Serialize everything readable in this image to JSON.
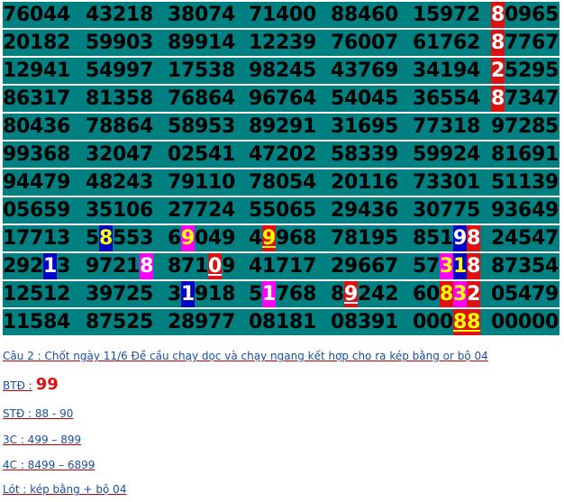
{
  "grid": {
    "rows": [
      [
        "76044",
        "43218",
        "38074",
        "71400",
        "88460",
        "15972",
        "80965"
      ],
      [
        "20182",
        "59903",
        "89914",
        "12239",
        "76007",
        "61762",
        "87767"
      ],
      [
        "12941",
        "54997",
        "17538",
        "98245",
        "43769",
        "34194",
        "25295"
      ],
      [
        "86317",
        "81358",
        "76864",
        "96764",
        "54045",
        "36554",
        "87347"
      ],
      [
        "80436",
        "78864",
        "58953",
        "89291",
        "31695",
        "77318",
        "97285"
      ],
      [
        "99368",
        "32047",
        "02541",
        "47202",
        "58339",
        "59924",
        "81691"
      ],
      [
        "94479",
        "48243",
        "79110",
        "78054",
        "20116",
        "73301",
        "51139"
      ],
      [
        "05659",
        "35106",
        "27724",
        "55065",
        "29436",
        "30775",
        "93649"
      ],
      [
        "17713",
        "58553",
        "69049",
        "49968",
        "78195",
        "85198",
        "24547"
      ],
      [
        "29213",
        "97218",
        "87109",
        "41717",
        "29667",
        "57318",
        "87354"
      ],
      [
        "12512",
        "39725",
        "31918",
        "51768",
        "89242",
        "60832",
        "05479"
      ],
      [
        "11584",
        "87525",
        "28977",
        "08181",
        "08391",
        "00088",
        "00000"
      ]
    ],
    "highlights": [
      {
        "row": 0,
        "col": 6,
        "pos": 0,
        "style": "red"
      },
      {
        "row": 1,
        "col": 6,
        "pos": 0,
        "style": "red"
      },
      {
        "row": 2,
        "col": 6,
        "pos": 0,
        "style": "red"
      },
      {
        "row": 3,
        "col": 6,
        "pos": 0,
        "style": "red"
      },
      {
        "row": 8,
        "col": 1,
        "pos": 1,
        "style": "blue-yellow"
      },
      {
        "row": 8,
        "col": 2,
        "pos": 1,
        "style": "magenta-yellow"
      },
      {
        "row": 8,
        "col": 3,
        "pos": 1,
        "style": "red-yellow-underline"
      },
      {
        "row": 8,
        "col": 5,
        "pos": 3,
        "style": "blue"
      },
      {
        "row": 8,
        "col": 5,
        "pos": 4,
        "style": "red"
      },
      {
        "row": 9,
        "col": 0,
        "pos": 3,
        "style": "blue"
      },
      {
        "row": 9,
        "col": 1,
        "pos": 4,
        "style": "magenta"
      },
      {
        "row": 9,
        "col": 2,
        "pos": 3,
        "style": "red-underline"
      },
      {
        "row": 9,
        "col": 5,
        "pos": 2,
        "style": "magenta-yellow"
      },
      {
        "row": 9,
        "col": 5,
        "pos": 3,
        "style": "blue-yellow"
      },
      {
        "row": 9,
        "col": 5,
        "pos": 4,
        "style": "red"
      },
      {
        "row": 10,
        "col": 2,
        "pos": 1,
        "style": "blue"
      },
      {
        "row": 10,
        "col": 3,
        "pos": 1,
        "style": "magenta"
      },
      {
        "row": 10,
        "col": 4,
        "pos": 1,
        "style": "red-underline"
      },
      {
        "row": 10,
        "col": 5,
        "pos": 2,
        "style": "red-yellow"
      },
      {
        "row": 10,
        "col": 5,
        "pos": 3,
        "style": "magenta-yellow"
      },
      {
        "row": 10,
        "col": 5,
        "pos": 4,
        "style": "red"
      },
      {
        "row": 11,
        "col": 5,
        "pos": 3,
        "style": "red-yellow-underline"
      },
      {
        "row": 11,
        "col": 5,
        "pos": 4,
        "style": "red-yellow-underline"
      }
    ]
  },
  "notes": {
    "cau2": "Câu 2 : Chốt ngày 11/6 Đề cầu chạy dọc và chạy ngang kết hợp cho ra kép bằng or bộ 04",
    "btd_label": "BTĐ :",
    "btd_value": "99",
    "std": "STĐ : 88 - 90",
    "c3": "3C : 499 – 899",
    "c4": "4C : 8499 – 6899",
    "lot": "Lót : kép bằng + bộ 04"
  },
  "colors": {
    "grid_bg": "#008080",
    "highlight_red": "#e01010",
    "highlight_blue": "#0000c8",
    "highlight_magenta": "#ff00ff",
    "highlight_text_yellow": "#ffff00",
    "note_text": "#1a4fa0"
  }
}
